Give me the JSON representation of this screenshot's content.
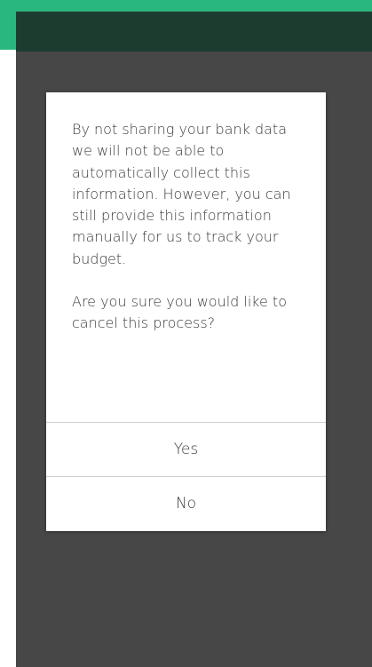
{
  "dialog": {
    "message": "By not sharing your bank data we will not be able to automatically collect this information. However, you can still provide this information manually for us to track your budget.",
    "question": "Are you sure you would like to cancel this process?",
    "yes_label": "Yes",
    "no_label": "No"
  },
  "colors": {
    "accent": "#2ab77e",
    "header": "#1d3c30",
    "overlay": "#474747"
  }
}
